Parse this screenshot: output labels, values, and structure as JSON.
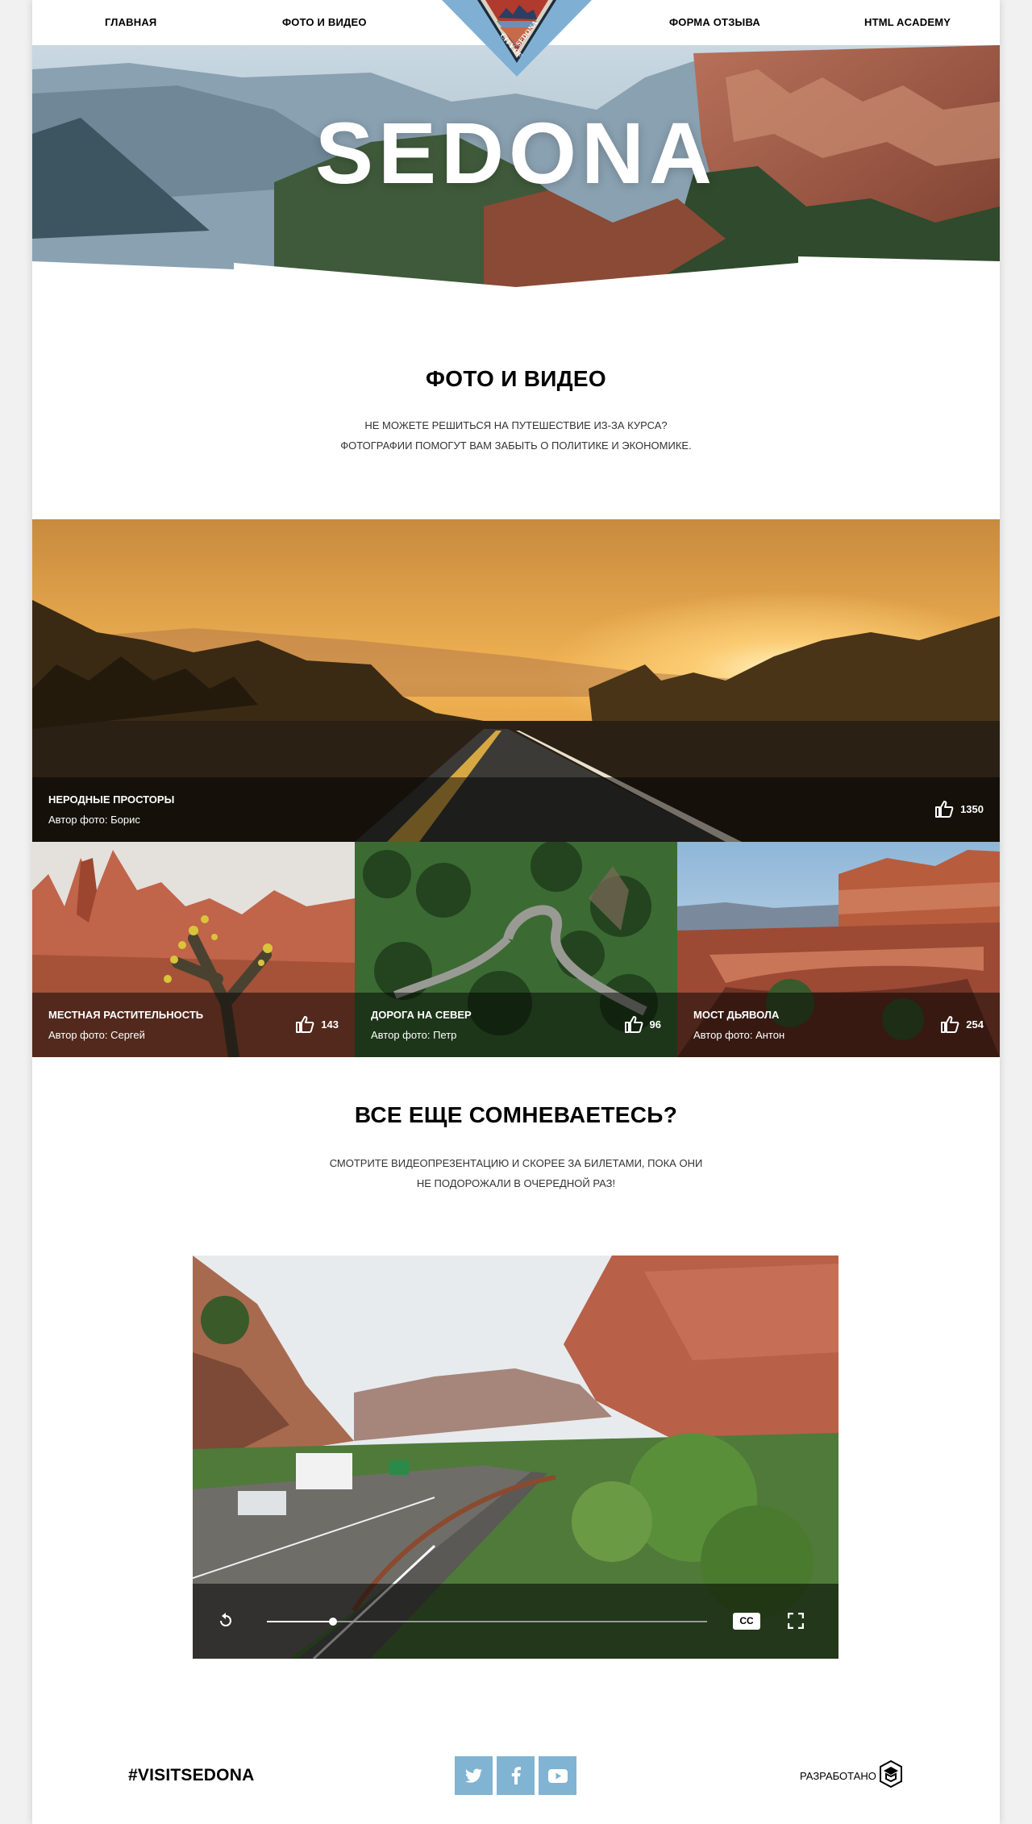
{
  "nav": {
    "home": "Главная",
    "photo_video": "Фото и видео",
    "feedback": "Форма отзыва",
    "academy": "HTML Academy"
  },
  "logo": {
    "text_top": "CITY OF",
    "text_bottom": "SEDONA"
  },
  "hero": {
    "title": "SEDONA"
  },
  "intro": {
    "title": "Фото и видео",
    "line1": "Не можете решиться на путешествие из-за курса?",
    "line2": "Фотографии помогут вам забыть о политике и экономике."
  },
  "gallery": {
    "main": {
      "title": "Неродные просторы",
      "author": "Автор фото: Борис",
      "likes": "1350"
    },
    "items": [
      {
        "title": "Местная растительность",
        "author": "Автор фото: Сергей",
        "likes": "143"
      },
      {
        "title": "Дорога на север",
        "author": "Автор фото: Петр",
        "likes": "96"
      },
      {
        "title": "Мост дьявола",
        "author": "Автор фото: Антон",
        "likes": "254"
      }
    ]
  },
  "doubt": {
    "title": "Все еще сомневаетесь?",
    "line1": "Смотрите видеопрезентацию и скорее за билетами, пока они",
    "line2": "не подорожали в очередной раз!"
  },
  "video": {
    "progress": 0.15,
    "cc_label": "CC",
    "icons": [
      "replay-icon",
      "cc-icon",
      "fullscreen-icon"
    ]
  },
  "footer": {
    "hashtag": "#visitsedona",
    "developed_by": "Разработано",
    "social": [
      "twitter-icon",
      "facebook-icon",
      "youtube-icon"
    ]
  },
  "colors": {
    "social_bg": "#81b3d2",
    "logo_blue": "#7fb0d4",
    "caption_overlay": "rgba(0,0,0,0.5)"
  }
}
